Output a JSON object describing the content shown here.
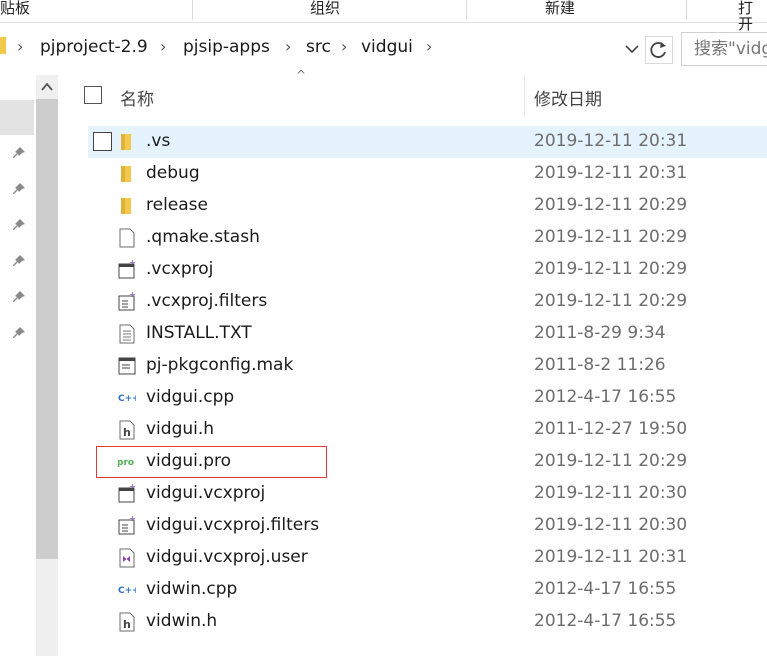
{
  "ribbon": {
    "groups": [
      "贴板",
      "组织",
      "新建",
      "打开"
    ]
  },
  "address": {
    "crumbs": [
      "pjproject-2.9",
      "pjsip-apps",
      "src",
      "vidgui"
    ],
    "search_placeholder": "搜索\"vidgui\""
  },
  "header": {
    "name_label": "名称",
    "date_label": "修改日期"
  },
  "files": [
    {
      "name": ".vs",
      "date": "2019-12-11 20:31",
      "icon": "folder-icon"
    },
    {
      "name": "debug",
      "date": "2019-12-11 20:31",
      "icon": "folder-icon"
    },
    {
      "name": "release",
      "date": "2019-12-11 20:29",
      "icon": "folder-icon"
    },
    {
      "name": ".qmake.stash",
      "date": "2019-12-11 20:29",
      "icon": "blank-file-icon"
    },
    {
      "name": ".vcxproj",
      "date": "2019-12-11 20:29",
      "icon": "vcxproj-icon"
    },
    {
      "name": ".vcxproj.filters",
      "date": "2019-12-11 20:29",
      "icon": "filters-icon"
    },
    {
      "name": "INSTALL.TXT",
      "date": "2011-8-29 9:34",
      "icon": "text-file-icon"
    },
    {
      "name": "pj-pkgconfig.mak",
      "date": "2011-8-2 11:26",
      "icon": "mak-file-icon"
    },
    {
      "name": "vidgui.cpp",
      "date": "2012-4-17 16:55",
      "icon": "cpp-file-icon"
    },
    {
      "name": "vidgui.h",
      "date": "2011-12-27 19:50",
      "icon": "header-file-icon"
    },
    {
      "name": "vidgui.pro",
      "date": "2019-12-11 20:29",
      "icon": "pro-file-icon"
    },
    {
      "name": "vidgui.vcxproj",
      "date": "2019-12-11 20:30",
      "icon": "vcxproj-icon"
    },
    {
      "name": "vidgui.vcxproj.filters",
      "date": "2019-12-11 20:30",
      "icon": "filters-icon"
    },
    {
      "name": "vidgui.vcxproj.user",
      "date": "2019-12-11 20:31",
      "icon": "vs-user-file-icon"
    },
    {
      "name": "vidwin.cpp",
      "date": "2012-4-17 16:55",
      "icon": "cpp-file-icon"
    },
    {
      "name": "vidwin.h",
      "date": "2012-4-17 16:55",
      "icon": "header-file-icon"
    }
  ],
  "colors": {
    "hover_row": "#e5f3ff",
    "folder": "#f2c94c",
    "highlight": "#e53935",
    "date_text": "#6d6d6d"
  }
}
